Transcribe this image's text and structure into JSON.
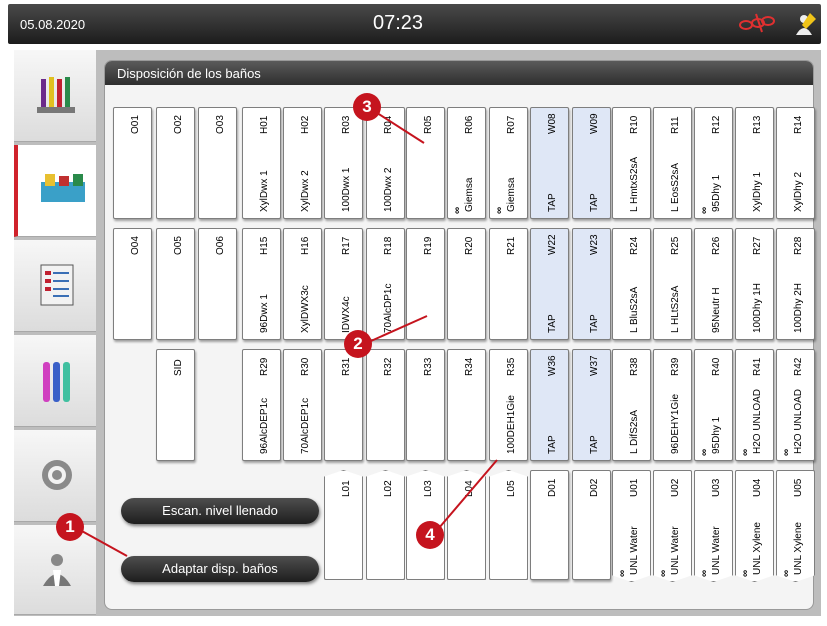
{
  "header": {
    "date": "05.08.2020",
    "time": "07:23"
  },
  "sidebar": {
    "items": [
      {
        "name": "reagents-icon"
      },
      {
        "name": "bath-layout-icon"
      },
      {
        "name": "programs-icon"
      },
      {
        "name": "reagent-tubes-icon"
      },
      {
        "name": "settings-icon"
      },
      {
        "name": "user-icon"
      }
    ]
  },
  "panel": {
    "title": "Disposición de los baños"
  },
  "slots_row1": [
    {
      "id": "O01",
      "label": "",
      "type": "oven"
    },
    {
      "id": "O02",
      "label": "",
      "type": "oven"
    },
    {
      "id": "O03",
      "label": "",
      "type": "oven"
    },
    {
      "id": "H01",
      "label": "XylDwx 1",
      "type": "h"
    },
    {
      "id": "H02",
      "label": "XylDwx 2",
      "type": "h"
    },
    {
      "id": "R03",
      "label": "100Dwx 1",
      "type": "r"
    },
    {
      "id": "R04",
      "label": "100Dwx 2",
      "type": "r"
    },
    {
      "id": "R05",
      "label": "",
      "type": "r"
    },
    {
      "id": "R06",
      "label": "Giemsa",
      "type": "r",
      "inf": true
    },
    {
      "id": "R07",
      "label": "Giemsa",
      "type": "r",
      "inf": true
    },
    {
      "id": "W08",
      "label": "TAP",
      "type": "w"
    },
    {
      "id": "W09",
      "label": "TAP",
      "type": "w"
    },
    {
      "id": "R10",
      "label": "L HmtxS2sA",
      "type": "r"
    },
    {
      "id": "R11",
      "label": "L EosS2sA",
      "type": "r"
    },
    {
      "id": "R12",
      "label": "95Dhy 1",
      "type": "r",
      "inf": true
    },
    {
      "id": "R13",
      "label": "XylDhy 1",
      "type": "r"
    },
    {
      "id": "R14",
      "label": "XylDhy 2",
      "type": "r"
    }
  ],
  "slots_row2": [
    {
      "id": "O04",
      "label": ""
    },
    {
      "id": "O05",
      "label": ""
    },
    {
      "id": "O06",
      "label": ""
    },
    {
      "id": "H15",
      "label": "96Dwx 1"
    },
    {
      "id": "H16",
      "label": "XylDWX3c"
    },
    {
      "id": "R17",
      "label": "IDWX4c"
    },
    {
      "id": "R18",
      "label": "70AlcDP1c"
    },
    {
      "id": "R19",
      "label": ""
    },
    {
      "id": "R20",
      "label": ""
    },
    {
      "id": "R21",
      "label": ""
    },
    {
      "id": "W22",
      "label": "TAP",
      "type": "w"
    },
    {
      "id": "W23",
      "label": "TAP",
      "type": "w"
    },
    {
      "id": "R24",
      "label": "L BluS2sA"
    },
    {
      "id": "R25",
      "label": "L HLtS2sA"
    },
    {
      "id": "R26",
      "label": "95Neutr H"
    },
    {
      "id": "R27",
      "label": "100Dhy 1H"
    },
    {
      "id": "R28",
      "label": "100Dhy 2H"
    }
  ],
  "slots_row3": [
    {
      "id": "SID",
      "label": ""
    },
    {
      "id": "R29",
      "label": "96AlcDEP1c"
    },
    {
      "id": "R30",
      "label": "70AlcDEP1c"
    },
    {
      "id": "R31",
      "label": ""
    },
    {
      "id": "R32",
      "label": ""
    },
    {
      "id": "R33",
      "label": ""
    },
    {
      "id": "R34",
      "label": ""
    },
    {
      "id": "R35",
      "label": "100DEH1Gie"
    },
    {
      "id": "W36",
      "label": "TAP",
      "type": "w"
    },
    {
      "id": "W37",
      "label": "TAP",
      "type": "w"
    },
    {
      "id": "R38",
      "label": "L DifS2sA"
    },
    {
      "id": "R39",
      "label": "96DEHY1Gie"
    },
    {
      "id": "R40",
      "label": "95Dhy 1",
      "inf": true
    },
    {
      "id": "R41",
      "label": "H2O UNLOAD",
      "inf": true
    },
    {
      "id": "R42",
      "label": "H2O UNLOAD",
      "inf": true
    }
  ],
  "slots_row4": [
    {
      "id": "L01"
    },
    {
      "id": "L02"
    },
    {
      "id": "L03"
    },
    {
      "id": "L04"
    },
    {
      "id": "L05"
    },
    {
      "id": "D01",
      "label": ""
    },
    {
      "id": "D02",
      "label": ""
    },
    {
      "id": "U01",
      "label": "UNL Water",
      "inf": true
    },
    {
      "id": "U02",
      "label": "UNL Water",
      "inf": true
    },
    {
      "id": "U03",
      "label": "UNL Water",
      "inf": true
    },
    {
      "id": "U04",
      "label": "UNL Xylene",
      "inf": true
    },
    {
      "id": "U05",
      "label": "UNL Xylene",
      "inf": true
    }
  ],
  "buttons": {
    "scan_fill": "Escan. nivel llenado",
    "adapt_baths": "Adaptar disp. baños"
  },
  "callouts": [
    "1",
    "2",
    "3",
    "4"
  ],
  "infinity": "∞",
  "colors": {
    "accent_red": "#c5141e",
    "water_blue": "#dfe7f6"
  }
}
